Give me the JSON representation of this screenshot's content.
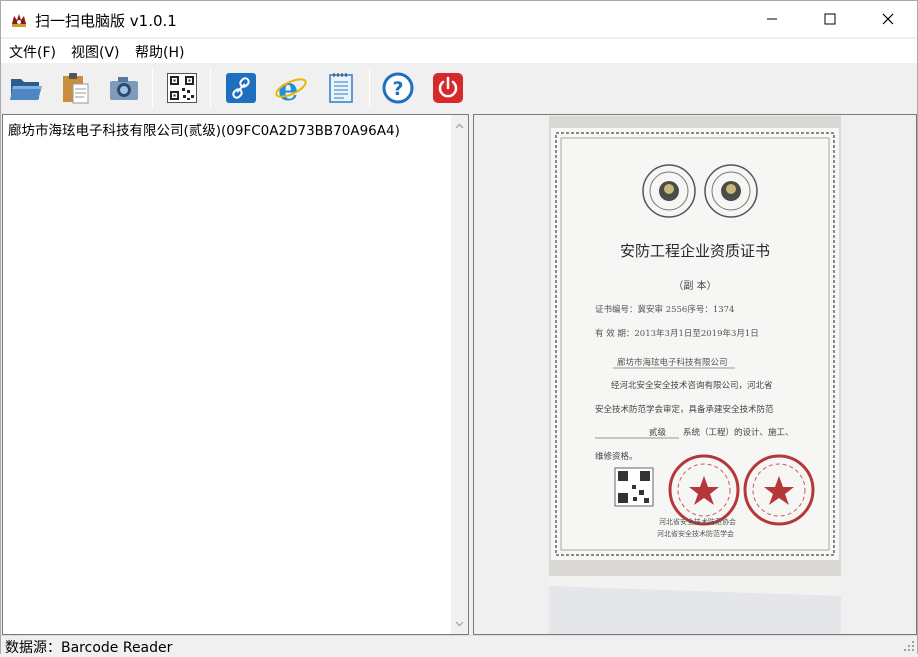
{
  "window": {
    "title": "扫一扫电脑版 v1.0.1"
  },
  "menu": {
    "items": [
      "文件(F)",
      "视图(V)",
      "帮助(H)"
    ]
  },
  "toolbar": {
    "buttons": [
      "open-folder",
      "paste",
      "camera",
      "qr-code",
      "link",
      "internet-explorer",
      "notepad",
      "help",
      "power"
    ]
  },
  "result": {
    "text": "廊坊市海玹电子科技有限公司(贰级)(09FC0A2D73BB70A96A4)"
  },
  "certificate": {
    "title": "安防工程企业资质证书",
    "copy": "（副  本）",
    "number": "证书编号：冀安审   2556序号：1374",
    "validity": "有 效 期：2013年3月1日至2019年3月1日",
    "company": "廊坊市海玹电子科技有限公司",
    "body": [
      "经河北安全安全技术咨询有限公司，河北省",
      "安全技术防范学会审定，具备承建安全技术防范",
      "系统（工程）的设计、施工、",
      "维修资格。"
    ],
    "grade": "贰级",
    "issuer": [
      "河北省安全技术防范协会",
      "河北省安全技术防范学会"
    ]
  },
  "status": {
    "text": "数据源：Barcode Reader"
  },
  "colors": {
    "accent": "#1e6fbf",
    "power": "#d62a2a",
    "seal": "#b5373a"
  }
}
